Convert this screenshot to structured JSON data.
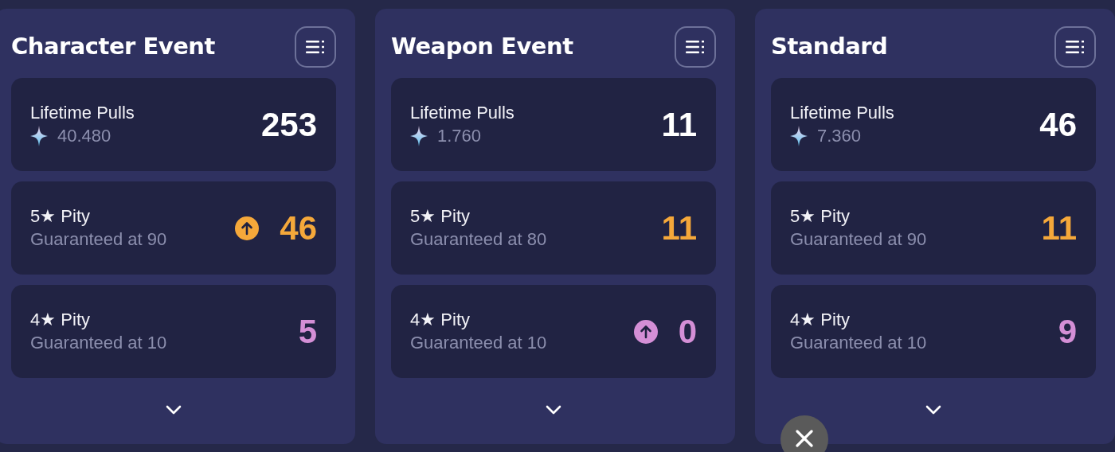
{
  "panels": [
    {
      "title": "Character Event",
      "stats": [
        {
          "kind": "pulls",
          "label": "Lifetime Pulls",
          "sub": "40.480",
          "value": "253"
        },
        {
          "kind": "pity",
          "label": "5★ Pity",
          "sub": "Guaranteed at 90",
          "value": "46",
          "color": "#f5a83a",
          "rate_up": true
        },
        {
          "kind": "pity",
          "label": "4★ Pity",
          "sub": "Guaranteed at 10",
          "value": "5",
          "color": "#d48fd6",
          "rate_up": false
        }
      ]
    },
    {
      "title": "Weapon Event",
      "stats": [
        {
          "kind": "pulls",
          "label": "Lifetime Pulls",
          "sub": "1.760",
          "value": "11"
        },
        {
          "kind": "pity",
          "label": "5★ Pity",
          "sub": "Guaranteed at 80",
          "value": "11",
          "color": "#f5a83a",
          "rate_up": false
        },
        {
          "kind": "pity",
          "label": "4★ Pity",
          "sub": "Guaranteed at 10",
          "value": "0",
          "color": "#d48fd6",
          "rate_up": true
        }
      ]
    },
    {
      "title": "Standard",
      "stats": [
        {
          "kind": "pulls",
          "label": "Lifetime Pulls",
          "sub": "7.360",
          "value": "46"
        },
        {
          "kind": "pity",
          "label": "5★ Pity",
          "sub": "Guaranteed at 90",
          "value": "11",
          "color": "#f5a83a",
          "rate_up": false
        },
        {
          "kind": "pity",
          "label": "4★ Pity",
          "sub": "Guaranteed at 10",
          "value": "9",
          "color": "#d48fd6",
          "rate_up": false
        }
      ]
    }
  ],
  "close_button": {
    "visible": true
  }
}
